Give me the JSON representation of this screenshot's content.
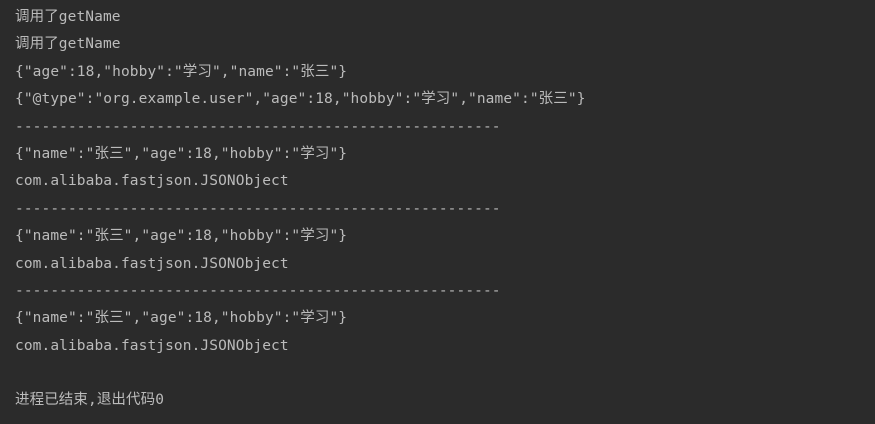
{
  "console": {
    "lines": [
      "调用了getName",
      "调用了getName",
      "{\"age\":18,\"hobby\":\"学习\",\"name\":\"张三\"}",
      "{\"@type\":\"org.example.user\",\"age\":18,\"hobby\":\"学习\",\"name\":\"张三\"}",
      "-------------------------------------------------------",
      "{\"name\":\"张三\",\"age\":18,\"hobby\":\"学习\"}",
      "com.alibaba.fastjson.JSONObject",
      "-------------------------------------------------------",
      "{\"name\":\"张三\",\"age\":18,\"hobby\":\"学习\"}",
      "com.alibaba.fastjson.JSONObject",
      "-------------------------------------------------------",
      "{\"name\":\"张三\",\"age\":18,\"hobby\":\"学习\"}",
      "com.alibaba.fastjson.JSONObject",
      "",
      "进程已结束,退出代码0"
    ]
  },
  "colors": {
    "background": "#2b2b2b",
    "text": "#bbbbbb"
  }
}
